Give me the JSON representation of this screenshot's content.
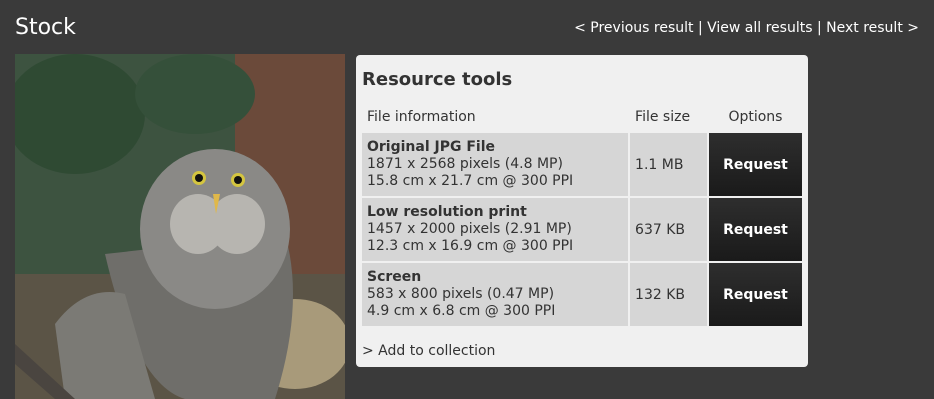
{
  "page": {
    "title": "Stock"
  },
  "nav": {
    "previous": "< Previous result",
    "sep1": "|",
    "all": "View all results",
    "sep2": "|",
    "next": "Next result >"
  },
  "resource_tools": {
    "title": "Resource tools",
    "headers": {
      "info": "File information",
      "size": "File size",
      "options": "Options"
    },
    "rows": [
      {
        "name": "Original JPG File",
        "pixels": "1871 x 2568 pixels (4.8 MP)",
        "print": "15.8 cm x 21.7 cm @ 300 PPI",
        "size": "1.1 MB",
        "button": "Request"
      },
      {
        "name": "Low resolution print",
        "pixels": "1457 x 2000 pixels (2.91 MP)",
        "print": "12.3 cm x 16.9 cm @ 300 PPI",
        "size": "637 KB",
        "button": "Request"
      },
      {
        "name": "Screen",
        "pixels": "583 x 800 pixels (0.47 MP)",
        "print": "4.9 cm x 6.8 cm @ 300 PPI",
        "size": "132 KB",
        "button": "Request"
      }
    ],
    "add_to_collection": "> Add to collection"
  },
  "colors": {
    "background": "#3a3a3a",
    "panel": "#f0f0f0",
    "row": "#d6d6d6",
    "button": "#1f1f1f"
  }
}
